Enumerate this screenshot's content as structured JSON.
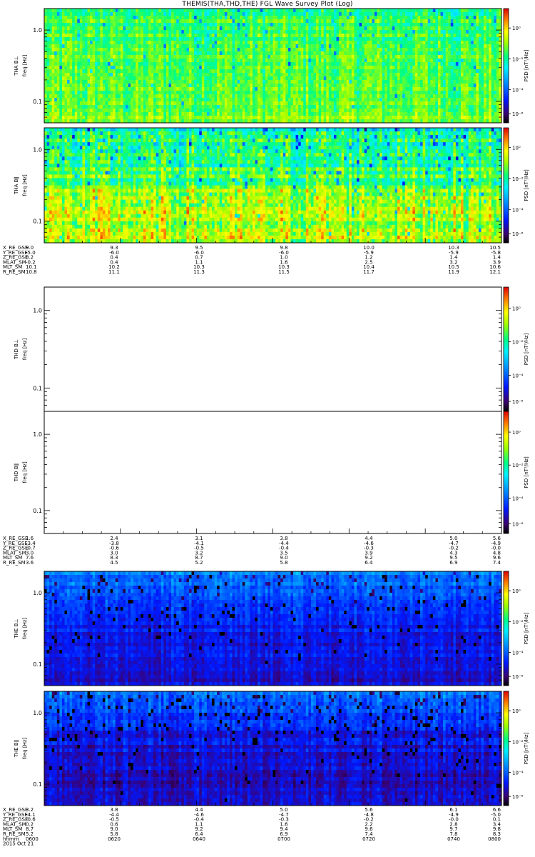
{
  "title": "THEMIS(THA,THD,THE) FGL Wave Survey Plot (Log)",
  "chart_data": {
    "type": "heatmap",
    "ylabel": "freq [Hz]",
    "y_ticks": [
      "1.0",
      "0.1"
    ],
    "colorbar_label": "PSD [nT²/Hz]",
    "colorbar_ticks": [
      "10⁰",
      "10⁻²",
      "10⁻⁴",
      "10⁻⁶"
    ],
    "panels": [
      {
        "label": "THA B⊥",
        "state": "a_perp"
      },
      {
        "label": "THA B∥",
        "state": "a_par"
      },
      {
        "label": "THD B⊥",
        "state": "empty"
      },
      {
        "label": "THD B∥",
        "state": "empty"
      },
      {
        "label": "THE B⊥",
        "state": "e_perp"
      },
      {
        "label": "THE B∥",
        "state": "e_par"
      }
    ],
    "ephemeris": [
      {
        "probe": "THA",
        "rows": [
          {
            "name": "X_RE_GSE",
            "values": [
              "9.0",
              "9.3",
              "9.5",
              "9.8",
              "10.0",
              "10.3",
              "10.5"
            ]
          },
          {
            "name": "Y_RE_GSE",
            "values": [
              "-5.0",
              "-6.0",
              "-6.0",
              "-6.0",
              "-5.9",
              "-5.9",
              "-5.8"
            ]
          },
          {
            "name": "Z_RE_GSE",
            "values": [
              "0.2",
              "0.4",
              "0.7",
              "1.0",
              "1.2",
              "1.4",
              "1.4"
            ]
          },
          {
            "name": "MLAT_SM",
            "values": [
              "-0.2",
              "0.4",
              "1.1",
              "1.6",
              "2.5",
              "3.2",
              "3.9"
            ]
          },
          {
            "name": "MLT_SM",
            "values": [
              "10.1",
              "10.2",
              "10.3",
              "10.3",
              "10.4",
              "10.5",
              "10.6"
            ]
          },
          {
            "name": "R_RE_SM",
            "values": [
              "10.8",
              "11.1",
              "11.3",
              "11.5",
              "11.7",
              "11.9",
              "12.1"
            ]
          }
        ]
      },
      {
        "probe": "THD",
        "rows": [
          {
            "name": "X_RE_GSE",
            "values": [
              "1.6",
              "2.4",
              "3.1",
              "3.8",
              "4.4",
              "5.0",
              "5.6"
            ]
          },
          {
            "name": "Y_RE_GSE",
            "values": [
              "-3.4",
              "-3.8",
              "-4.1",
              "-4.4",
              "-4.6",
              "-4.7",
              "-4.9"
            ]
          },
          {
            "name": "Z_RE_GSE",
            "values": [
              "-0.7",
              "-0.6",
              "-0.5",
              "-0.4",
              "-0.3",
              "-0.2",
              "-0.0"
            ]
          },
          {
            "name": "MLAT_SM",
            "values": [
              "3.0",
              "3.0",
              "3.2",
              "3.5",
              "3.9",
              "4.3",
              "4.8"
            ]
          },
          {
            "name": "MLT_SM",
            "values": [
              "7.6",
              "8.3",
              "8.7",
              "9.0",
              "9.2",
              "9.5",
              "9.6"
            ]
          },
          {
            "name": "R_RE_SM",
            "values": [
              "3.6",
              "4.5",
              "5.2",
              "5.8",
              "6.4",
              "6.9",
              "7.4"
            ]
          }
        ]
      },
      {
        "probe": "THE",
        "rows": [
          {
            "name": "X_RE_GSE",
            "values": [
              "3.2",
              "3.8",
              "4.4",
              "5.0",
              "5.6",
              "6.1",
              "6.6"
            ]
          },
          {
            "name": "Y_RE_GSE",
            "values": [
              "-4.1",
              "-4.4",
              "-4.6",
              "-4.7",
              "-4.8",
              "-4.9",
              "-5.0"
            ]
          },
          {
            "name": "Z_RE_GSE",
            "values": [
              "-0.6",
              "-0.5",
              "-0.4",
              "-0.3",
              "-0.2",
              "-0.0",
              "0.1"
            ]
          },
          {
            "name": "MLAT_SM",
            "values": [
              "0.2",
              "0.6",
              "1.1",
              "1.6",
              "2.2",
              "2.8",
              "3.4"
            ]
          },
          {
            "name": "MLT_SM",
            "values": [
              "8.7",
              "9.0",
              "9.2",
              "9.4",
              "9.6",
              "9.7",
              "9.8"
            ]
          },
          {
            "name": "R_RE_SM",
            "values": [
              "5.2",
              "5.8",
              "6.4",
              "6.9",
              "7.4",
              "7.8",
              "8.3"
            ]
          },
          {
            "name": "hhmm",
            "values": [
              "0600",
              "0620",
              "0640",
              "0700",
              "0720",
              "0740",
              "0800"
            ]
          }
        ],
        "date": "2015 Oct 21"
      }
    ]
  }
}
